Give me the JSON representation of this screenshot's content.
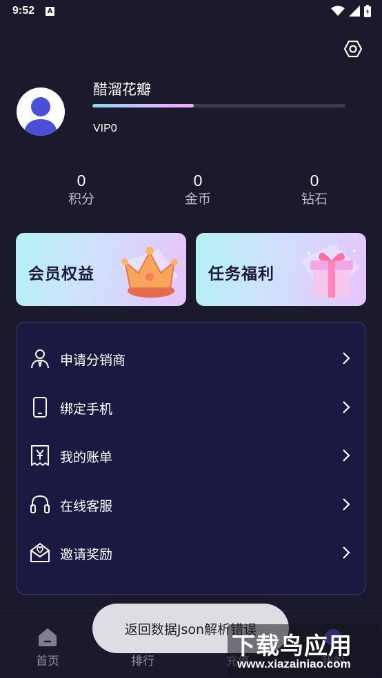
{
  "status_bar": {
    "time": "9:52",
    "notification_icon": "A"
  },
  "header": {
    "settings_icon": "settings-hex-icon"
  },
  "profile": {
    "username": "醋溜花瓣",
    "level": "VIP0",
    "level_progress": 0.4
  },
  "stats": [
    {
      "value": "0",
      "label": "积分"
    },
    {
      "value": "0",
      "label": "金币"
    },
    {
      "value": "0",
      "label": "钻石"
    }
  ],
  "promos": [
    {
      "title": "会员权益",
      "icon": "crown-icon"
    },
    {
      "title": "任务福利",
      "icon": "gift-box-icon"
    }
  ],
  "menu": [
    {
      "label": "申请分销商",
      "icon": "distributor-icon"
    },
    {
      "label": "绑定手机",
      "icon": "phone-icon"
    },
    {
      "label": "我的账单",
      "icon": "bill-icon"
    },
    {
      "label": "在线客服",
      "icon": "headset-icon"
    },
    {
      "label": "邀请奖励",
      "icon": "invite-mail-icon"
    }
  ],
  "tabs": [
    {
      "label": "首页",
      "icon": "home-icon"
    },
    {
      "label": "排行",
      "icon": "rank-icon"
    },
    {
      "label": "充值",
      "icon": "recharge-icon"
    },
    {
      "label": "我的",
      "icon": "mine-icon"
    }
  ],
  "toast": {
    "message": "返回数据Json解析错误"
  },
  "watermark": {
    "title": "下载鸟应用",
    "url": "www.xiazainiao.com"
  },
  "colors": {
    "background": "#1b1a2c",
    "card": "#1b1942",
    "progress_gradient_start": "#7fe3ef",
    "progress_gradient_end": "#f3a6ff"
  }
}
